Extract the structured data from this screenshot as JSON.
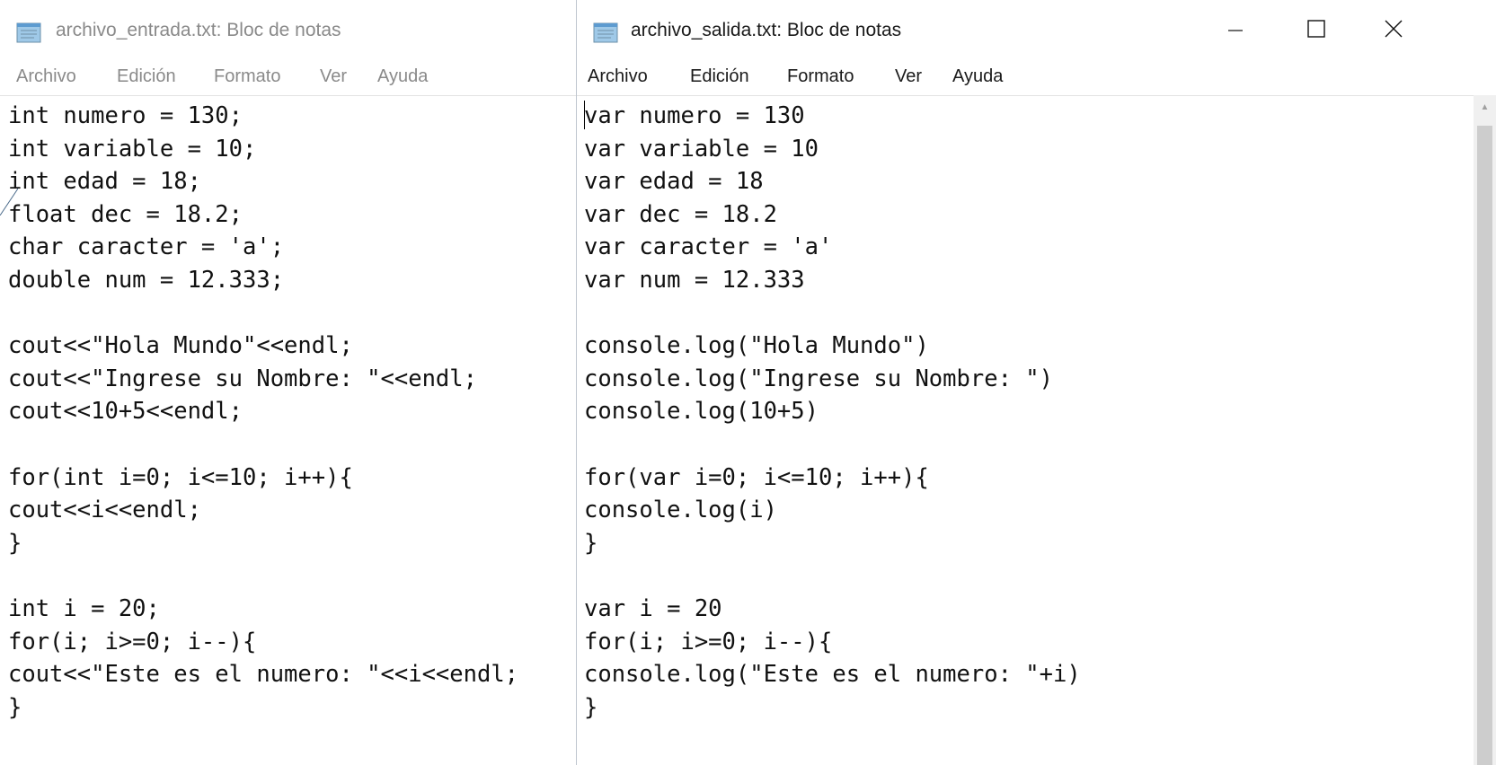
{
  "left_window": {
    "title": "archivo_entrada.txt: Bloc de notas",
    "menu": [
      "Archivo",
      "Edición",
      "Formato",
      "Ver",
      "Ayuda"
    ],
    "content": "int numero = 130;\nint variable = 10;\nint edad = 18;\nfloat dec = 18.2;\nchar caracter = 'a';\ndouble num = 12.333;\n\ncout<<\"Hola Mundo\"<<endl;\ncout<<\"Ingrese su Nombre: \"<<endl;\ncout<<10+5<<endl;\n\nfor(int i=0; i<=10; i++){\ncout<<i<<endl;\n}\n\nint i = 20;\nfor(i; i>=0; i--){\ncout<<\"Este es el numero: \"<<i<<endl;\n}"
  },
  "right_window": {
    "title": "archivo_salida.txt: Bloc de notas",
    "menu": [
      "Archivo",
      "Edición",
      "Formato",
      "Ver",
      "Ayuda"
    ],
    "content": "var numero = 130\nvar variable = 10\nvar edad = 18\nvar dec = 18.2\nvar caracter = 'a'\nvar num = 12.333\n\nconsole.log(\"Hola Mundo\")\nconsole.log(\"Ingrese su Nombre: \")\nconsole.log(10+5)\n\nfor(var i=0; i<=10; i++){\nconsole.log(i)\n}\n\nvar i = 20\nfor(i; i>=0; i--){\nconsole.log(\"Este es el numero: \"+i)\n}"
  },
  "window_controls": [
    "minimize",
    "maximize",
    "close"
  ],
  "icons": [
    "notepad-icon",
    "minimize-icon",
    "maximize-icon",
    "close-icon"
  ]
}
